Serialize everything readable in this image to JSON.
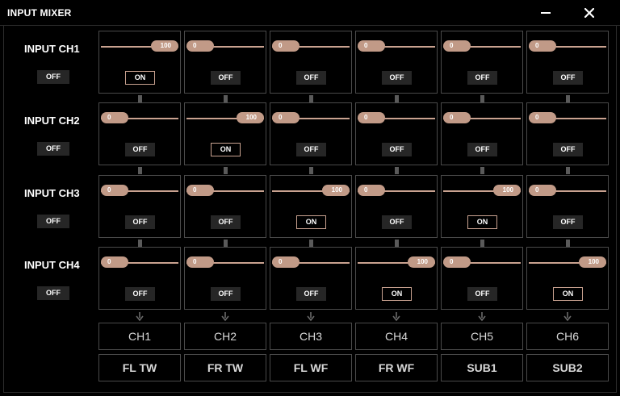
{
  "window": {
    "title": "INPUT MIXER",
    "minimize_icon": "minimize-icon",
    "close_icon": "close-icon"
  },
  "colors": {
    "background": "#000000",
    "accent": "#c19a87",
    "toggle_off_bg": "#262626",
    "cell_border": "#4a4a4a"
  },
  "rows": [
    {
      "label": "INPUT CH1",
      "toggle": "OFF",
      "cells": [
        {
          "value": "100",
          "level": 100,
          "state": "ON"
        },
        {
          "value": "0",
          "level": 0,
          "state": "OFF"
        },
        {
          "value": "0",
          "level": 0,
          "state": "OFF"
        },
        {
          "value": "0",
          "level": 0,
          "state": "OFF"
        },
        {
          "value": "0",
          "level": 0,
          "state": "OFF"
        },
        {
          "value": "0",
          "level": 0,
          "state": "OFF"
        }
      ]
    },
    {
      "label": "INPUT CH2",
      "toggle": "OFF",
      "cells": [
        {
          "value": "0",
          "level": 0,
          "state": "OFF"
        },
        {
          "value": "100",
          "level": 100,
          "state": "ON"
        },
        {
          "value": "0",
          "level": 0,
          "state": "OFF"
        },
        {
          "value": "0",
          "level": 0,
          "state": "OFF"
        },
        {
          "value": "0",
          "level": 0,
          "state": "OFF"
        },
        {
          "value": "0",
          "level": 0,
          "state": "OFF"
        }
      ]
    },
    {
      "label": "INPUT CH3",
      "toggle": "OFF",
      "cells": [
        {
          "value": "0",
          "level": 0,
          "state": "OFF"
        },
        {
          "value": "0",
          "level": 0,
          "state": "OFF"
        },
        {
          "value": "100",
          "level": 100,
          "state": "ON"
        },
        {
          "value": "0",
          "level": 0,
          "state": "OFF"
        },
        {
          "value": "100",
          "level": 100,
          "state": "ON"
        },
        {
          "value": "0",
          "level": 0,
          "state": "OFF"
        }
      ]
    },
    {
      "label": "INPUT CH4",
      "toggle": "OFF",
      "cells": [
        {
          "value": "0",
          "level": 0,
          "state": "OFF"
        },
        {
          "value": "0",
          "level": 0,
          "state": "OFF"
        },
        {
          "value": "0",
          "level": 0,
          "state": "OFF"
        },
        {
          "value": "100",
          "level": 100,
          "state": "ON"
        },
        {
          "value": "0",
          "level": 0,
          "state": "OFF"
        },
        {
          "value": "100",
          "level": 100,
          "state": "ON"
        }
      ]
    }
  ],
  "outputs": {
    "channels": [
      "CH1",
      "CH2",
      "CH3",
      "CH4",
      "CH5",
      "CH6"
    ],
    "assignments": [
      "FL TW",
      "FR TW",
      "FL WF",
      "FR WF",
      "SUB1",
      "SUB2"
    ]
  }
}
